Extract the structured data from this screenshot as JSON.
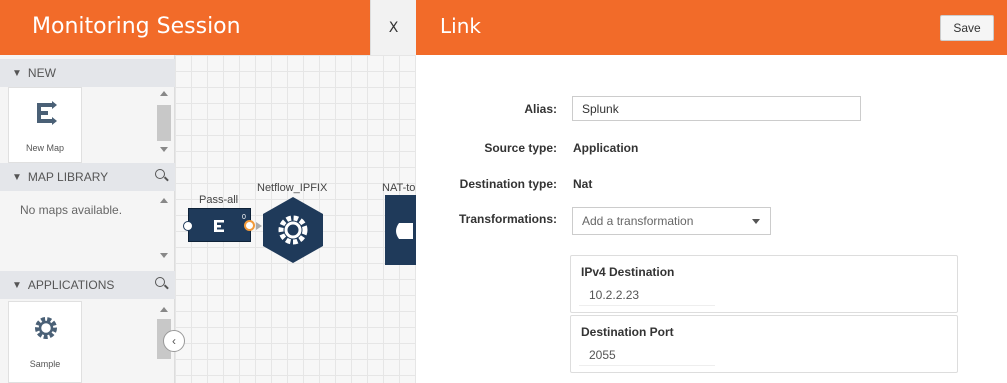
{
  "session": {
    "title": "Monitoring Session",
    "close_label": "X"
  },
  "sidebar": {
    "new": {
      "label": "NEW",
      "tile_label": "New Map"
    },
    "map_library": {
      "label": "MAP LIBRARY",
      "empty_text": "No maps available."
    },
    "applications": {
      "label": "APPLICATIONS",
      "tile_label": "Sample"
    }
  },
  "canvas": {
    "nodes": [
      {
        "label": "Pass-all",
        "type": "map"
      },
      {
        "label": "Netflow_IPFIX",
        "type": "application"
      },
      {
        "label": "NAT-to",
        "type": "nat"
      }
    ],
    "port_label": "0"
  },
  "link_panel": {
    "title": "Link",
    "save_label": "Save",
    "fields": {
      "alias_label": "Alias:",
      "alias_value": "Splunk",
      "source_type_label": "Source type:",
      "source_type_value": "Application",
      "destination_type_label": "Destination type:",
      "destination_type_value": "Nat",
      "transformations_label": "Transformations:",
      "transformations_placeholder": "Add a transformation"
    },
    "transformations": [
      {
        "title": "IPv4 Destination",
        "value": "10.2.2.23"
      },
      {
        "title": "Destination Port",
        "value": "2055"
      }
    ]
  },
  "colors": {
    "accent": "#f26b29",
    "node_dark": "#1f3a5a"
  }
}
